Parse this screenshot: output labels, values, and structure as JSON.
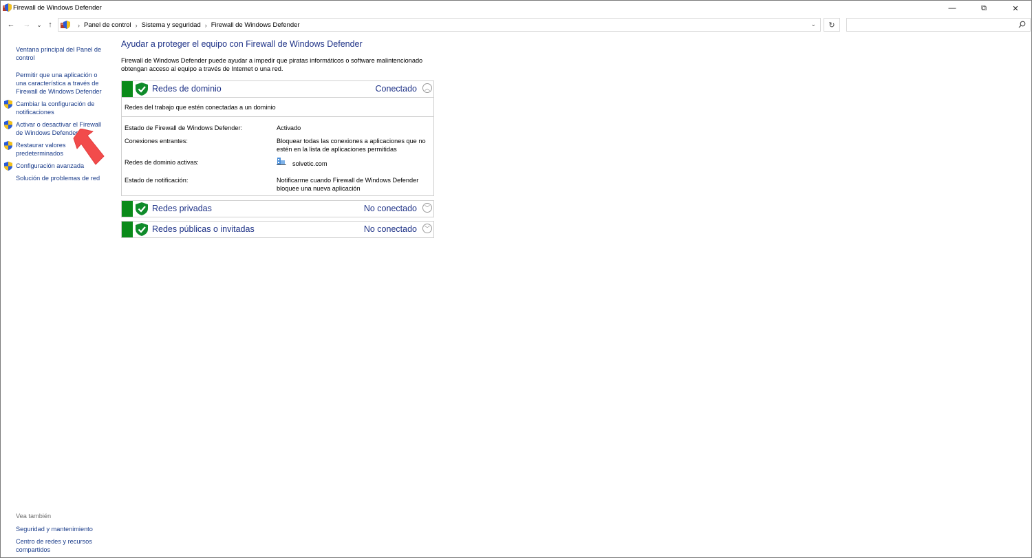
{
  "window": {
    "title": "Firewall de Windows Defender",
    "controls": {
      "minimize": "—",
      "restore": "⧉",
      "close": "✕"
    }
  },
  "nav": {
    "back": "←",
    "forward": "→",
    "recent": "⌄",
    "up": "↑",
    "breadcrumbs": [
      "Panel de control",
      "Sistema y seguridad",
      "Firewall de Windows Defender"
    ],
    "separator": "›",
    "dropdown": "⌄",
    "refresh": "↻",
    "search_placeholder": ""
  },
  "sidebar": {
    "links": [
      {
        "label": "Ventana principal del Panel de control",
        "shield": false
      },
      {
        "label": "Permitir que una aplicación o una característica a través de Firewall de Windows Defender",
        "shield": false
      },
      {
        "label": "Cambiar la configuración de notificaciones",
        "shield": true
      },
      {
        "label": "Activar o desactivar el Firewall de Windows Defender",
        "shield": true
      },
      {
        "label": "Restaurar valores predeterminados",
        "shield": true
      },
      {
        "label": "Configuración avanzada",
        "shield": true
      },
      {
        "label": "Solución de problemas de red",
        "shield": false
      }
    ],
    "see_also_label": "Vea también",
    "see_also": [
      "Seguridad y mantenimiento",
      "Centro de redes y recursos compartidos"
    ]
  },
  "main": {
    "heading": "Ayudar a proteger el equipo con Firewall de Windows Defender",
    "intro": "Firewall de Windows Defender puede ayudar a impedir que piratas informáticos o software malintencionado obtengan acceso al equipo a través de Internet o una red.",
    "panels": [
      {
        "title": "Redes de dominio",
        "status": "Conectado",
        "expanded": true,
        "description": "Redes del trabajo que estén conectadas a un dominio",
        "details": [
          {
            "label": "Estado de Firewall de Windows Defender:",
            "value": "Activado"
          },
          {
            "label": "Conexiones entrantes:",
            "value": "Bloquear todas las conexiones a aplicaciones que no estén en la lista de aplicaciones permitidas"
          },
          {
            "label": "Redes de dominio activas:",
            "value": "solvetic.com"
          },
          {
            "label": "Estado de notificación:",
            "value": "Notificarme cuando Firewall de Windows Defender bloquee una nueva aplicación"
          }
        ]
      },
      {
        "title": "Redes privadas",
        "status": "No conectado",
        "expanded": false
      },
      {
        "title": "Redes públicas o invitadas",
        "status": "No conectado",
        "expanded": false
      }
    ]
  },
  "colors": {
    "link": "#1a3c8a",
    "heading": "#1e3287",
    "status_green": "#0a8a19",
    "annotation_arrow": "#f24b4b"
  },
  "icons": {
    "app": "firewall-icon",
    "shield": "shield-icon",
    "domain": "domain-network-icon"
  },
  "chevrons": {
    "up": "︿",
    "down": "﹀"
  }
}
